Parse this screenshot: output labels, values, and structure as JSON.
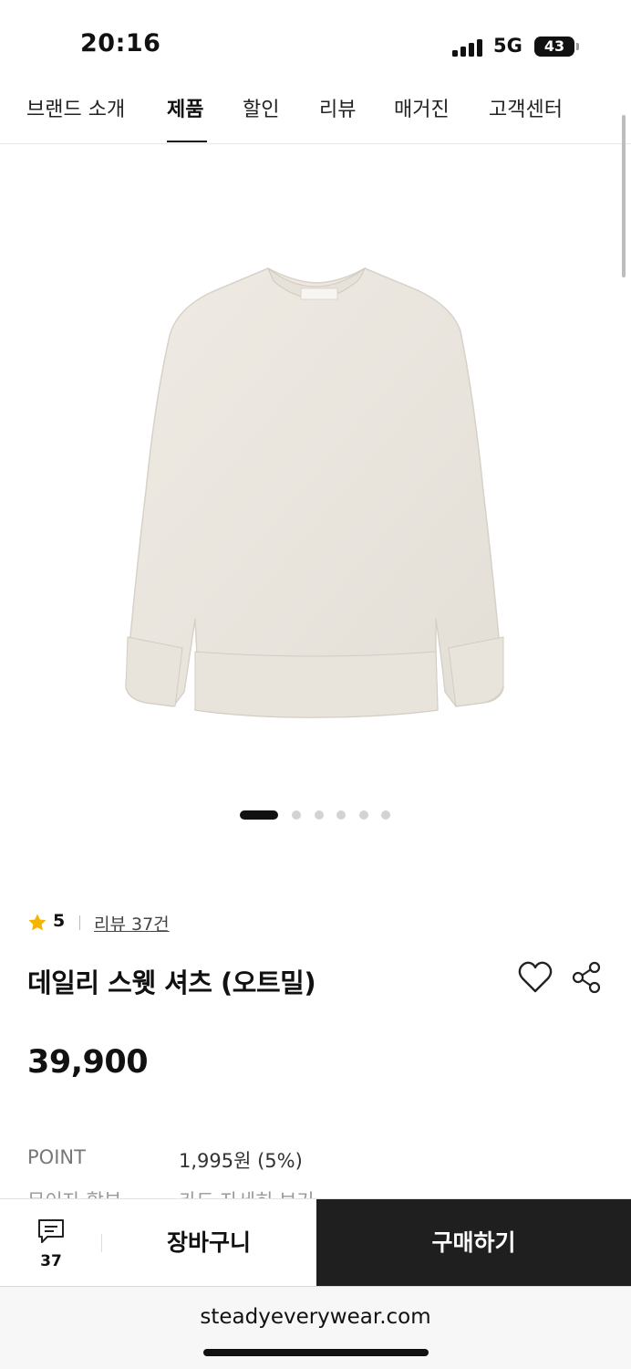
{
  "status_bar": {
    "time": "20:16",
    "network": "5G",
    "battery": "43"
  },
  "nav": {
    "items": [
      {
        "label": "브랜드 소개"
      },
      {
        "label": "제품"
      },
      {
        "label": "할인"
      },
      {
        "label": "리뷰"
      },
      {
        "label": "매거진"
      },
      {
        "label": "고객센터"
      }
    ],
    "active": "제품"
  },
  "gallery": {
    "total_images": 6,
    "current_index": 1
  },
  "product": {
    "rating": "5",
    "review_link": "리뷰 37건",
    "title": "데일리 스웻 셔츠 (오트밀)",
    "price": "39,900",
    "point_label": "POINT",
    "point_value": "1,995원 (5%)",
    "cut_label": "무이자 할부",
    "cut_value": "카드 자세히 보기"
  },
  "bottom_bar": {
    "chat_count": "37",
    "cart_label": "장바구니",
    "buy_label": "구매하기"
  },
  "browser": {
    "url": "steadyeverywear.com"
  },
  "colors": {
    "accent_dark": "#1f1f1f",
    "star": "#f5b400",
    "sweater": "#ebe7e0"
  }
}
